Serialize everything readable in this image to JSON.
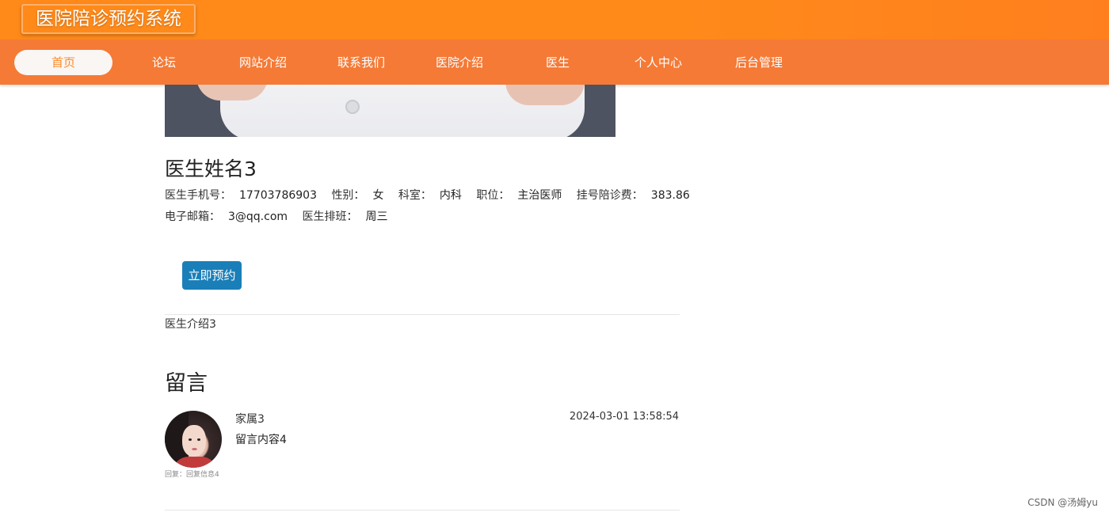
{
  "header": {
    "site_title": "医院陪诊预约系统"
  },
  "nav": {
    "items": [
      {
        "label": "首页",
        "active": true
      },
      {
        "label": "论坛"
      },
      {
        "label": "网站介绍"
      },
      {
        "label": "联系我们"
      },
      {
        "label": "医院介绍"
      },
      {
        "label": "医生"
      },
      {
        "label": "个人中心"
      },
      {
        "label": "后台管理"
      }
    ]
  },
  "doctor": {
    "name": "医生姓名3",
    "phone_label": "医生手机号：",
    "phone": "17703786903",
    "gender_label": "性别：",
    "gender": "女",
    "department_label": "科室：",
    "department": "内科",
    "title_label": "职位：",
    "title": "主治医师",
    "fee_label": "挂号陪诊费：",
    "fee": "383.86",
    "email_label": "电子邮箱：",
    "email": "3@qq.com",
    "schedule_label": "医生排班：",
    "schedule": "周三",
    "book_button": "立即预约",
    "intro": "医生介绍3"
  },
  "comments": {
    "section_title": "留言",
    "items": [
      {
        "user": "家属3",
        "content": "留言内容4",
        "time": "2024-03-01 13:58:54",
        "reply": "回复：回复信息4"
      }
    ]
  },
  "watermark": "CSDN @汤姆yu",
  "colors": {
    "header_bg": "#ff8a1a",
    "nav_bg": "#f47a36",
    "button_bg": "#1a7fb8"
  }
}
